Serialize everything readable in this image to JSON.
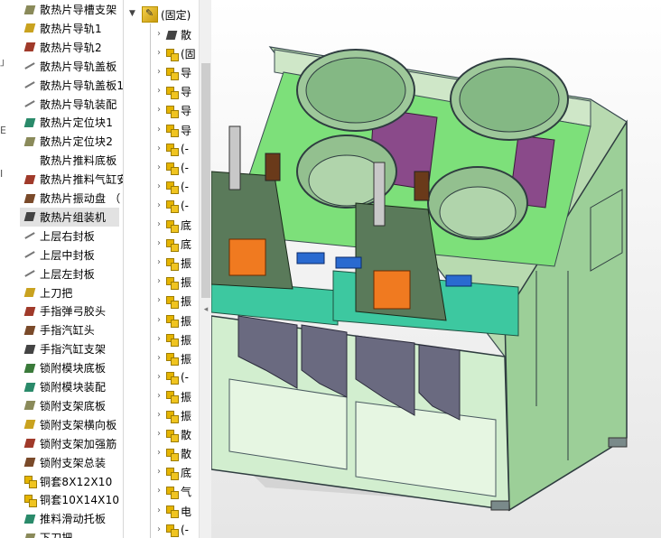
{
  "left_tree": {
    "edge_marks": [
      "」",
      "E",
      "I"
    ],
    "items": [
      {
        "label": "散热片导槽支架",
        "icon": "part-icon"
      },
      {
        "label": "散热片导轨1",
        "icon": "part-icon"
      },
      {
        "label": "散热片导轨2",
        "icon": "part-icon"
      },
      {
        "label": "散热片导轨盖板",
        "icon": "sheet-part-icon"
      },
      {
        "label": "散热片导轨盖板1",
        "icon": "sheet-part-icon"
      },
      {
        "label": "散热片导轨装配",
        "icon": "sheet-part-icon"
      },
      {
        "label": "散热片定位块1",
        "icon": "part-icon"
      },
      {
        "label": "散热片定位块2",
        "icon": "part-icon"
      },
      {
        "label": "散热片推料底板",
        "icon": "blank-icon"
      },
      {
        "label": "散热片推料气缸安",
        "icon": "part-icon"
      },
      {
        "label": "散热片振动盘 （",
        "icon": "part-icon"
      },
      {
        "label": "散热片组装机",
        "icon": "part-icon"
      },
      {
        "label": "上层右封板",
        "icon": "sheet-part-icon"
      },
      {
        "label": "上层中封板",
        "icon": "sheet-part-icon"
      },
      {
        "label": "上层左封板",
        "icon": "sheet-part-icon"
      },
      {
        "label": "上刀把",
        "icon": "part-icon"
      },
      {
        "label": "手指弹弓胶头",
        "icon": "part-icon"
      },
      {
        "label": "手指汽缸头",
        "icon": "part-icon"
      },
      {
        "label": "手指汽缸支架",
        "icon": "part-icon"
      },
      {
        "label": "锁附模块底板",
        "icon": "part-icon"
      },
      {
        "label": "锁附模块装配",
        "icon": "part-icon"
      },
      {
        "label": "锁附支架底板",
        "icon": "part-icon"
      },
      {
        "label": "锁附支架横向板",
        "icon": "part-icon"
      },
      {
        "label": "锁附支架加强筋",
        "icon": "part-icon"
      },
      {
        "label": "锁附支架总装",
        "icon": "part-icon"
      },
      {
        "label": "铜套8X12X10",
        "icon": "assembly-icon"
      },
      {
        "label": "铜套10X14X10",
        "icon": "assembly-icon"
      },
      {
        "label": "推料滑动托板",
        "icon": "part-icon"
      },
      {
        "label": "下刀把",
        "icon": "part-icon"
      }
    ]
  },
  "mid_tree": {
    "header_label": "(固定)",
    "rows": [
      {
        "label": "散",
        "icon": "folder-icon"
      },
      {
        "label": "(固",
        "icon": "assembly-icon"
      },
      {
        "label": "导",
        "icon": "assembly-icon"
      },
      {
        "label": "导",
        "icon": "assembly-icon"
      },
      {
        "label": "导",
        "icon": "assembly-icon"
      },
      {
        "label": "导",
        "icon": "assembly-icon"
      },
      {
        "label": "(-",
        "icon": "assembly-icon"
      },
      {
        "label": "(-",
        "icon": "assembly-icon"
      },
      {
        "label": "(-",
        "icon": "assembly-icon"
      },
      {
        "label": "(-",
        "icon": "assembly-icon"
      },
      {
        "label": "底",
        "icon": "assembly-icon"
      },
      {
        "label": "底",
        "icon": "assembly-icon"
      },
      {
        "label": "振",
        "icon": "assembly-icon"
      },
      {
        "label": "振",
        "icon": "assembly-icon"
      },
      {
        "label": "振",
        "icon": "assembly-icon"
      },
      {
        "label": "振",
        "icon": "assembly-icon"
      },
      {
        "label": "振",
        "icon": "assembly-icon"
      },
      {
        "label": "振",
        "icon": "assembly-icon"
      },
      {
        "label": "(-",
        "icon": "assembly-icon"
      },
      {
        "label": "振",
        "icon": "assembly-icon"
      },
      {
        "label": "振",
        "icon": "assembly-icon"
      },
      {
        "label": "散",
        "icon": "assembly-icon"
      },
      {
        "label": "散",
        "icon": "assembly-icon"
      },
      {
        "label": "底",
        "icon": "assembly-icon"
      },
      {
        "label": "气",
        "icon": "assembly-icon"
      },
      {
        "label": "电",
        "icon": "assembly-icon"
      },
      {
        "label": "(-",
        "icon": "assembly-icon"
      }
    ]
  },
  "viewport": {
    "model": "3d-assembly-model",
    "colors": {
      "frame": "#c8e3c0",
      "panel_green": "#a8d8a0",
      "bowl": "#8ab88a",
      "plate": "#3dc8a0",
      "tray_purple": "#8a4a8a",
      "lime": "#40e040",
      "orange": "#f07a20",
      "blue": "#2a6ad0",
      "dark": "#404a50"
    }
  }
}
